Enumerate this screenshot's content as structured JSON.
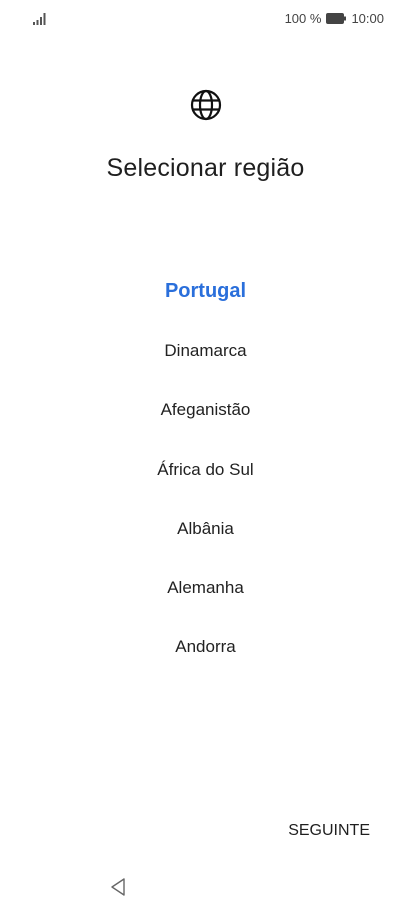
{
  "status_bar": {
    "battery_percent": "100 %",
    "time": "10:00"
  },
  "icons": {
    "globe": "globe-icon",
    "signal": "signal-icon",
    "battery": "battery-icon",
    "back": "back-triangle-icon"
  },
  "title": "Selecionar região",
  "regions": [
    {
      "label": "Portugal",
      "selected": true
    },
    {
      "label": "Dinamarca",
      "selected": false
    },
    {
      "label": "Afeganistão",
      "selected": false
    },
    {
      "label": "África do Sul",
      "selected": false
    },
    {
      "label": "Albânia",
      "selected": false
    },
    {
      "label": "Alemanha",
      "selected": false
    },
    {
      "label": "Andorra",
      "selected": false
    }
  ],
  "next_label": "SEGUINTE",
  "colors": {
    "accent": "#2a6fdb",
    "text": "#1f1f1f"
  }
}
